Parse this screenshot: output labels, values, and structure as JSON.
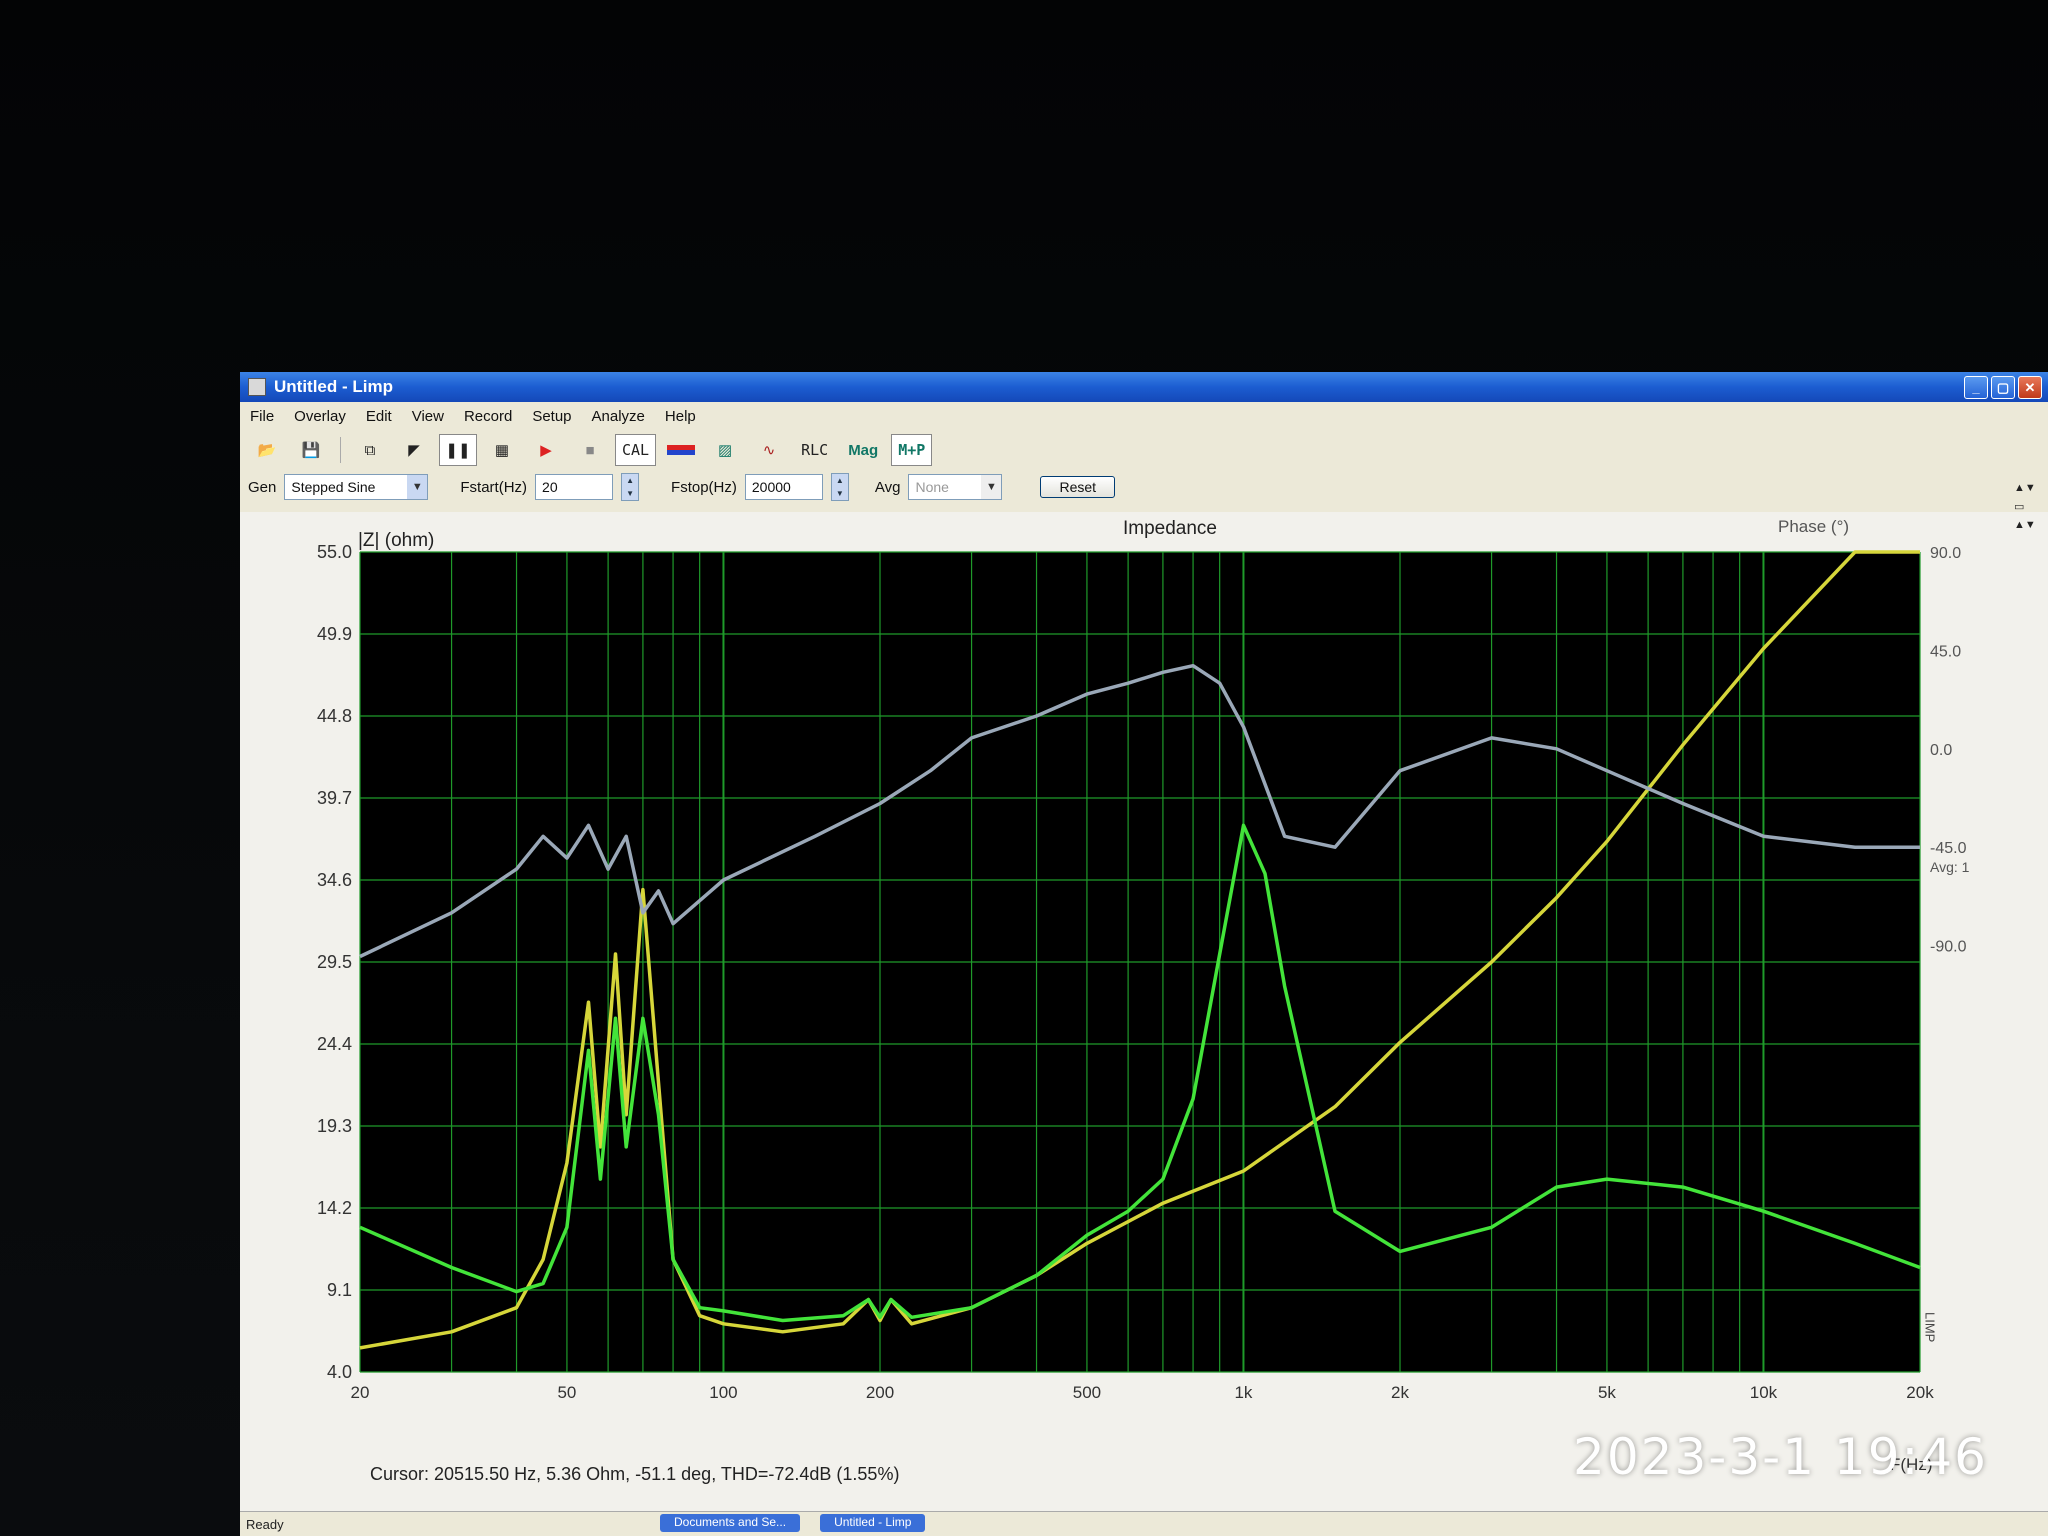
{
  "window": {
    "title": "Untitled - Limp"
  },
  "menu": [
    "File",
    "Overlay",
    "Edit",
    "View",
    "Record",
    "Setup",
    "Analyze",
    "Help"
  ],
  "toolbar": {
    "cal": "CAL",
    "rlc": "RLC",
    "mag": "Mag",
    "mp": "M+P"
  },
  "controls": {
    "gen_label": "Gen",
    "gen_value": "Stepped Sine",
    "fstart_label": "Fstart(Hz)",
    "fstart_value": "20",
    "fstop_label": "Fstop(Hz)",
    "fstop_value": "20000",
    "avg_label": "Avg",
    "avg_value": "None",
    "reset": "Reset"
  },
  "chart_data": {
    "type": "line",
    "title": "Impedance",
    "ylabel": "|Z| (ohm)",
    "y2label": "Phase (°)",
    "xlabel": "F(Hz)",
    "xscale": "log",
    "xlim": [
      20,
      20000
    ],
    "ylim": [
      4.0,
      55.0
    ],
    "y2lim": [
      -90,
      90
    ],
    "y_ticks": [
      "55.0",
      "49.9",
      "44.8",
      "39.7",
      "34.6",
      "29.5",
      "24.4",
      "19.3",
      "14.2",
      "9.1",
      "4.0"
    ],
    "y2_ticks": [
      "90.0",
      "45.0",
      "0.0",
      "-45.0",
      "-90.0"
    ],
    "x_ticks": [
      {
        "v": 20,
        "label": "20"
      },
      {
        "v": 50,
        "label": "50"
      },
      {
        "v": 100,
        "label": "100"
      },
      {
        "v": 200,
        "label": "200"
      },
      {
        "v": 500,
        "label": "500"
      },
      {
        "v": 1000,
        "label": "1k"
      },
      {
        "v": 2000,
        "label": "2k"
      },
      {
        "v": 5000,
        "label": "5k"
      },
      {
        "v": 10000,
        "label": "10k"
      },
      {
        "v": 20000,
        "label": "20k"
      }
    ],
    "grid": true,
    "avg_note": "Avg: 1",
    "limp_mark": "LIMP",
    "colors": {
      "bg": "#000000",
      "grid": "#1f9a2a",
      "series_a": "#d6d63a",
      "series_b": "#43e43a",
      "series_c": "#9aa8b8"
    },
    "series": [
      {
        "axis": "left",
        "color": "#d6d63a",
        "x": [
          20,
          30,
          40,
          45,
          50,
          55,
          58,
          62,
          65,
          70,
          75,
          80,
          90,
          100,
          130,
          170,
          190,
          200,
          210,
          230,
          300,
          400,
          500,
          700,
          1000,
          1500,
          2000,
          3000,
          4000,
          5000,
          7000,
          10000,
          15000,
          20000
        ],
        "y": [
          5.5,
          6.5,
          8.0,
          11,
          17,
          27,
          18,
          30,
          20,
          34,
          22,
          11,
          7.5,
          7.0,
          6.5,
          7.0,
          8.5,
          7.2,
          8.5,
          7.0,
          8.0,
          10.0,
          12.0,
          14.5,
          16.5,
          20.5,
          24.5,
          29.5,
          33.5,
          37.0,
          43.0,
          49.0,
          55.0,
          58.0
        ]
      },
      {
        "axis": "left",
        "color": "#43e43a",
        "x": [
          20,
          30,
          40,
          45,
          50,
          55,
          58,
          62,
          65,
          70,
          75,
          80,
          90,
          100,
          130,
          170,
          190,
          200,
          210,
          230,
          300,
          400,
          500,
          600,
          700,
          800,
          900,
          1000,
          1100,
          1200,
          1500,
          2000,
          3000,
          4000,
          5000,
          7000,
          10000,
          15000,
          20000
        ],
        "y": [
          13,
          10.5,
          9.0,
          9.5,
          13,
          24,
          16,
          26,
          18,
          26,
          20,
          11,
          8,
          7.8,
          7.2,
          7.5,
          8.5,
          7.4,
          8.5,
          7.4,
          8.0,
          10.0,
          12.5,
          14,
          16,
          21,
          30,
          38,
          35,
          28,
          14,
          11.5,
          13,
          15.5,
          16,
          15.5,
          14,
          12,
          10.5
        ]
      },
      {
        "axis": "right",
        "color": "#9aa8b8",
        "x": [
          20,
          30,
          40,
          45,
          50,
          55,
          60,
          65,
          70,
          75,
          80,
          100,
          150,
          200,
          250,
          300,
          400,
          500,
          600,
          700,
          800,
          900,
          1000,
          1200,
          1500,
          2000,
          3000,
          4000,
          5000,
          7000,
          10000,
          15000,
          20000
        ],
        "y": [
          -95,
          -75,
          -55,
          -40,
          -50,
          -35,
          -55,
          -40,
          -75,
          -65,
          -80,
          -60,
          -40,
          -25,
          -10,
          5,
          15,
          25,
          30,
          35,
          38,
          30,
          10,
          -40,
          -45,
          -10,
          5,
          0,
          -10,
          -25,
          -40,
          -45,
          -45
        ]
      }
    ],
    "cursor": "Cursor: 20515.50 Hz, 5.36 Ohm, -51.1 deg, THD=-72.4dB (1.55%)"
  },
  "status": {
    "ready": "Ready",
    "task_a": "Documents and Se...",
    "task_b": "Untitled - Limp"
  },
  "stamp": "2023-3-1  19:46"
}
